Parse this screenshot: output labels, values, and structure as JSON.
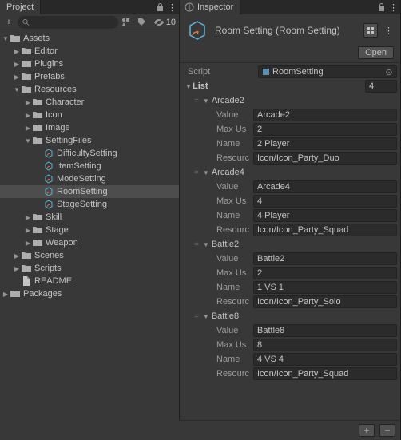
{
  "project": {
    "tab": "Project",
    "hidden_count": "10",
    "search_placeholder": "",
    "search_value": "",
    "tree": [
      {
        "depth": 0,
        "fold": "open",
        "icon": "folder",
        "label": "Assets"
      },
      {
        "depth": 1,
        "fold": "closed",
        "icon": "folder",
        "label": "Editor"
      },
      {
        "depth": 1,
        "fold": "closed",
        "icon": "folder",
        "label": "Plugins"
      },
      {
        "depth": 1,
        "fold": "closed",
        "icon": "folder",
        "label": "Prefabs"
      },
      {
        "depth": 1,
        "fold": "open",
        "icon": "folder",
        "label": "Resources"
      },
      {
        "depth": 2,
        "fold": "closed",
        "icon": "folder",
        "label": "Character"
      },
      {
        "depth": 2,
        "fold": "closed",
        "icon": "folder",
        "label": "Icon"
      },
      {
        "depth": 2,
        "fold": "closed",
        "icon": "folder",
        "label": "Image"
      },
      {
        "depth": 2,
        "fold": "open",
        "icon": "folder",
        "label": "SettingFiles"
      },
      {
        "depth": 3,
        "fold": "none",
        "icon": "so",
        "label": "DifficultySetting"
      },
      {
        "depth": 3,
        "fold": "none",
        "icon": "so",
        "label": "ItemSetting"
      },
      {
        "depth": 3,
        "fold": "none",
        "icon": "so",
        "label": "ModeSetting"
      },
      {
        "depth": 3,
        "fold": "none",
        "icon": "so",
        "label": "RoomSetting",
        "selected": true
      },
      {
        "depth": 3,
        "fold": "none",
        "icon": "so",
        "label": "StageSetting"
      },
      {
        "depth": 2,
        "fold": "closed",
        "icon": "folder",
        "label": "Skill"
      },
      {
        "depth": 2,
        "fold": "closed",
        "icon": "folder",
        "label": "Stage"
      },
      {
        "depth": 2,
        "fold": "closed",
        "icon": "folder",
        "label": "Weapon"
      },
      {
        "depth": 1,
        "fold": "closed",
        "icon": "folder",
        "label": "Scenes"
      },
      {
        "depth": 1,
        "fold": "closed",
        "icon": "folder",
        "label": "Scripts"
      },
      {
        "depth": 1,
        "fold": "none",
        "icon": "file",
        "label": "README"
      },
      {
        "depth": 0,
        "fold": "closed",
        "icon": "folder",
        "label": "Packages"
      }
    ]
  },
  "inspector": {
    "tab": "Inspector",
    "title": "Room Setting (Room Setting)",
    "open_label": "Open",
    "script_label": "Script",
    "script_value": "RoomSetting",
    "list_label": "List",
    "list_count": "4",
    "elements": [
      {
        "name": "Arcade2",
        "props": [
          {
            "label": "Value",
            "value": "Arcade2"
          },
          {
            "label": "Max Us",
            "value": "2"
          },
          {
            "label": "Name",
            "value": "2 Player"
          },
          {
            "label": "Resourc",
            "value": "Icon/Icon_Party_Duo"
          }
        ]
      },
      {
        "name": "Arcade4",
        "props": [
          {
            "label": "Value",
            "value": "Arcade4"
          },
          {
            "label": "Max Us",
            "value": "4"
          },
          {
            "label": "Name",
            "value": "4 Player"
          },
          {
            "label": "Resourc",
            "value": "Icon/Icon_Party_Squad"
          }
        ]
      },
      {
        "name": "Battle2",
        "props": [
          {
            "label": "Value",
            "value": "Battle2"
          },
          {
            "label": "Max Us",
            "value": "2"
          },
          {
            "label": "Name",
            "value": "1 VS 1"
          },
          {
            "label": "Resourc",
            "value": "Icon/Icon_Party_Solo"
          }
        ]
      },
      {
        "name": "Battle8",
        "props": [
          {
            "label": "Value",
            "value": "Battle8"
          },
          {
            "label": "Max Us",
            "value": "8"
          },
          {
            "label": "Name",
            "value": "4 VS 4"
          },
          {
            "label": "Resourc",
            "value": "Icon/Icon_Party_Squad"
          }
        ]
      }
    ]
  }
}
